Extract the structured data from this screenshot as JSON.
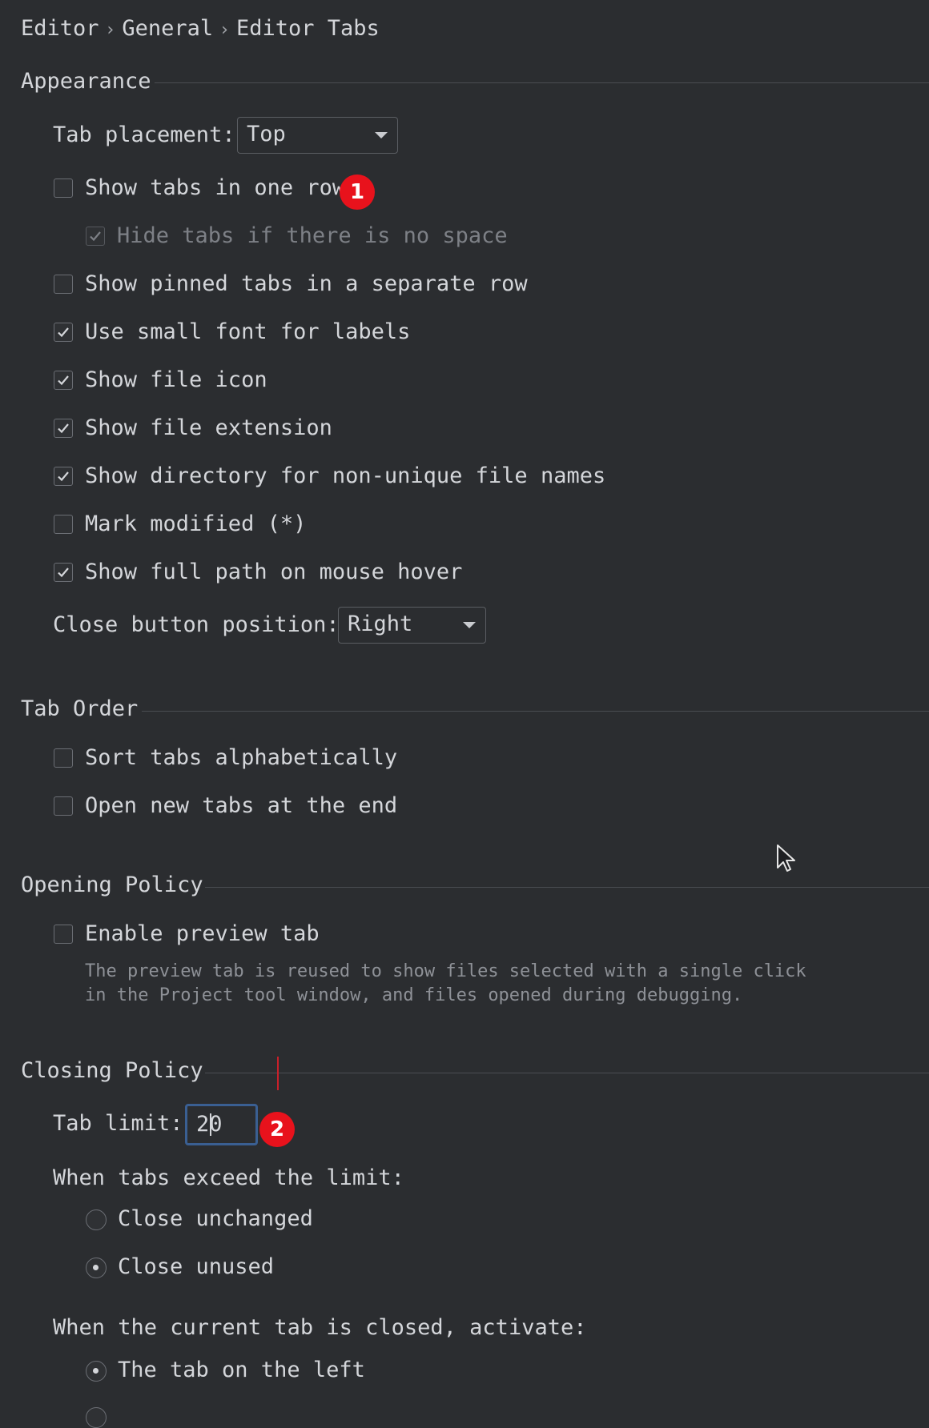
{
  "breadcrumb": [
    "Editor",
    "General",
    "Editor Tabs"
  ],
  "appearance": {
    "title": "Appearance",
    "tab_placement_label": "Tab placement:",
    "tab_placement_value": "Top",
    "close_button_position_label": "Close button position:",
    "close_button_position_value": "Right",
    "options": [
      {
        "label": "Show tabs in one row",
        "checked": false
      },
      {
        "label": "Hide tabs if there is no space",
        "checked": true,
        "disabled": true
      },
      {
        "label": "Show pinned tabs in a separate row",
        "checked": false
      },
      {
        "label": "Use small font for labels",
        "checked": true
      },
      {
        "label": "Show file icon",
        "checked": true
      },
      {
        "label": "Show file extension",
        "checked": true
      },
      {
        "label": "Show directory for non-unique file names",
        "checked": true
      },
      {
        "label": "Mark modified (*)",
        "checked": false
      },
      {
        "label": "Show full path on mouse hover",
        "checked": true
      }
    ]
  },
  "tab_order": {
    "title": "Tab Order",
    "options": [
      {
        "label": "Sort tabs alphabetically",
        "checked": false
      },
      {
        "label": "Open new tabs at the end",
        "checked": false
      }
    ]
  },
  "opening_policy": {
    "title": "Opening Policy",
    "options": [
      {
        "label": "Enable preview tab",
        "checked": false
      }
    ],
    "help_line1": "The preview tab is reused to show files selected with a single click",
    "help_line2": "in the Project tool window, and files opened during debugging."
  },
  "closing_policy": {
    "title": "Closing Policy",
    "tab_limit_label": "Tab limit:",
    "tab_limit_value": "20",
    "exceed_label": "When tabs exceed the limit:",
    "exceed_options": [
      {
        "label": "Close unchanged",
        "selected": false
      },
      {
        "label": "Close unused",
        "selected": true
      }
    ],
    "activate_label": "When the current tab is closed, activate:",
    "activate_options": [
      {
        "label": "The tab on the left",
        "selected": true
      }
    ]
  },
  "annotations": [
    "1",
    "2"
  ],
  "colors": {
    "background": "#2b2d30",
    "text": "#d4d6da",
    "badge": "#e8121c",
    "focus_border": "#3a5f92"
  }
}
